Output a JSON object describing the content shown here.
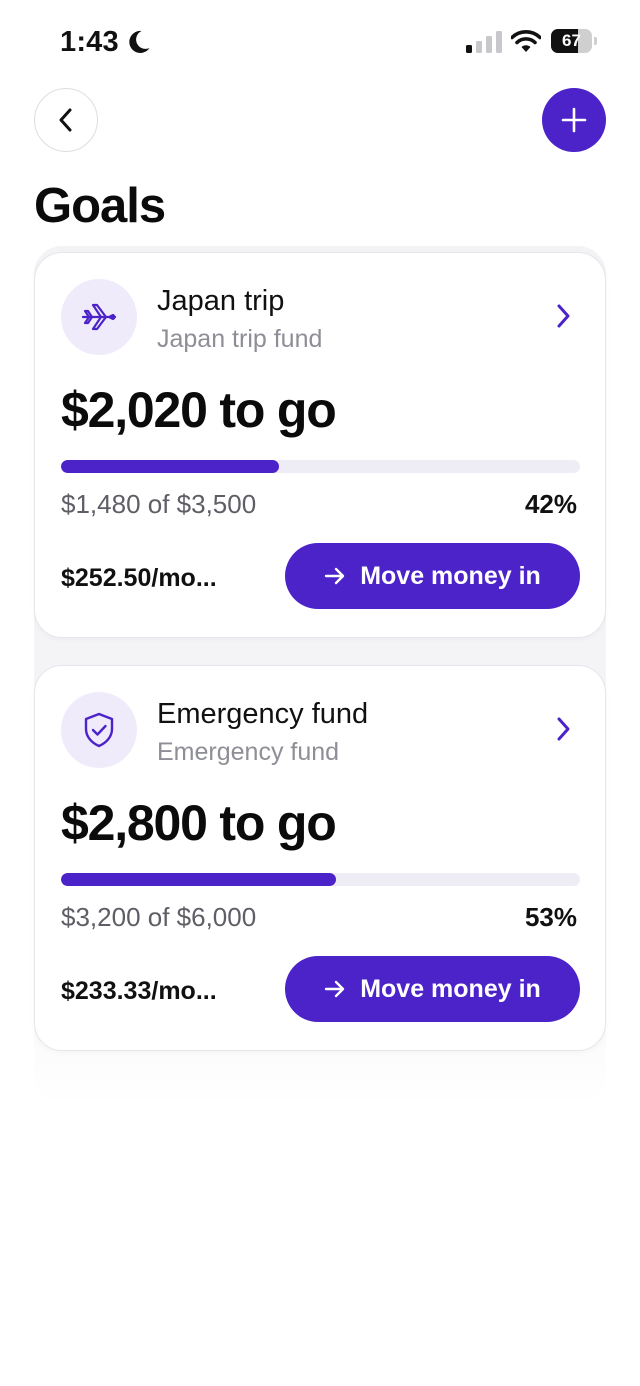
{
  "status_bar": {
    "time": "1:43",
    "battery_level": "67",
    "battery_fraction": 0.67
  },
  "header": {
    "title": "Goals",
    "back_icon": "chevron-left-icon",
    "add_icon": "plus-icon"
  },
  "colors": {
    "accent": "#4c22c9",
    "icon_bg": "#efebfb",
    "track": "#eeedf5"
  },
  "goals": [
    {
      "icon": "airplane-icon",
      "title": "Japan trip",
      "subtitle": "Japan trip fund",
      "remaining": "$2,020 to go",
      "progress_fraction": 0.42,
      "amounts": "$1,480 of $3,500",
      "percent": "42%",
      "monthly": "$252.50/mo...",
      "action_label": "Move money in"
    },
    {
      "icon": "shield-check-icon",
      "title": "Emergency fund",
      "subtitle": "Emergency fund",
      "remaining": "$2,800 to go",
      "progress_fraction": 0.53,
      "amounts": "$3,200 of $6,000",
      "percent": "53%",
      "monthly": "$233.33/mo...",
      "action_label": "Move money in"
    }
  ]
}
